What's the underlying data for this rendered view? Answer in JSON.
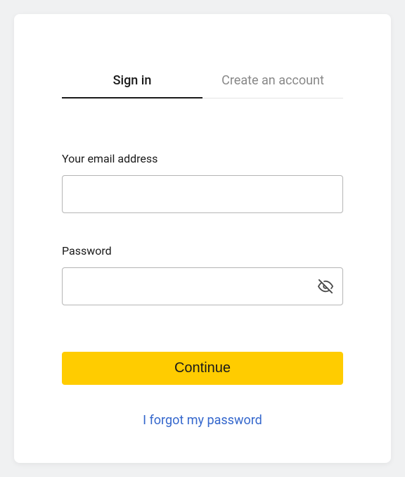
{
  "tabs": {
    "signin": "Sign in",
    "create": "Create an account"
  },
  "fields": {
    "email": {
      "label": "Your email address",
      "value": ""
    },
    "password": {
      "label": "Password",
      "value": ""
    }
  },
  "buttons": {
    "continue": "Continue"
  },
  "links": {
    "forgot": "I forgot my password"
  }
}
